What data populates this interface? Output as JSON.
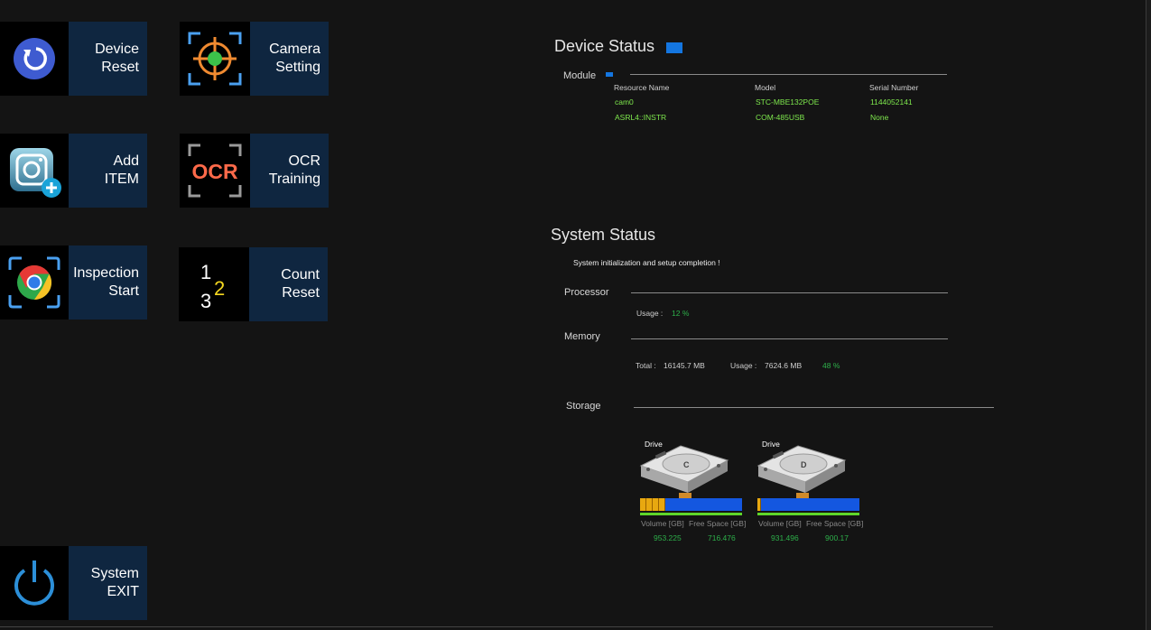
{
  "tiles": {
    "device_reset": {
      "line1": "Device",
      "line2": "Reset"
    },
    "camera_setting": {
      "line1": "Camera",
      "line2": "Setting"
    },
    "add_item": {
      "line1": "Add",
      "line2": "ITEM"
    },
    "ocr_training": {
      "line1": "OCR",
      "line2": "Training",
      "icon_text": "OCR"
    },
    "inspection_start": {
      "line1": "Inspection",
      "line2": "Start"
    },
    "count_reset": {
      "line1": "Count",
      "line2": "Reset",
      "icon_n1": "1",
      "icon_n2": "2",
      "icon_n3": "3"
    },
    "system_exit": {
      "line1": "System",
      "line2": "EXIT"
    }
  },
  "device_status": {
    "title": "Device Status",
    "module_label": "Module",
    "headers": [
      "Resource Name",
      "Model",
      "Serial Number"
    ],
    "rows": [
      [
        "cam0",
        "STC-MBE132POE",
        "1144052141"
      ],
      [
        "ASRL4::INSTR",
        "COM-485USB",
        "None"
      ]
    ]
  },
  "system_status": {
    "title": "System Status",
    "message": "System initialization and setup completion !",
    "processor_label": "Processor",
    "processor_usage_label": "Usage :",
    "processor_usage_value": "12 %",
    "memory_label": "Memory",
    "memory_total_label": "Total :",
    "memory_total_value": "16145.7 MB",
    "memory_usage_label": "Usage :",
    "memory_usage_value": "7624.6 MB",
    "memory_percent": "48 %",
    "storage_label": "Storage",
    "drives": [
      {
        "label": "Drive",
        "letter": "C",
        "volume_label": "Volume [GB]",
        "free_label": "Free Space [GB]",
        "volume": "953.225",
        "free": "716.476",
        "used_fraction": 0.25
      },
      {
        "label": "Drive",
        "letter": "D",
        "volume_label": "Volume [GB]",
        "free_label": "Free Space [GB]",
        "volume": "931.496",
        "free": "900.17",
        "used_fraction": 0.03
      }
    ]
  },
  "colors": {
    "accent_blue": "#1476e0",
    "tile_label_bg": "#0f2640",
    "value_green": "#3fd22a"
  }
}
